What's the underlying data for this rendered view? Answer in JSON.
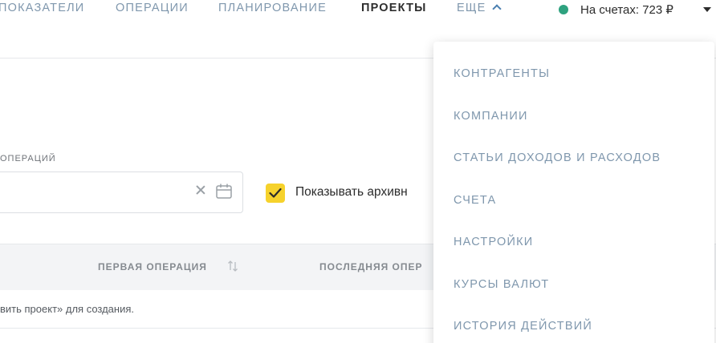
{
  "nav": {
    "items": [
      {
        "label": "ПОКАЗАТЕЛИ"
      },
      {
        "label": "ОПЕРАЦИИ"
      },
      {
        "label": "ПЛАНИРОВАНИЕ"
      },
      {
        "label": "ПРОЕКТЫ"
      },
      {
        "label": "ЕЩЕ"
      }
    ],
    "balance": "На счетах: 723 ₽"
  },
  "filters": {
    "date_label": "ОПЕРАЦИЙ",
    "show_archived_label": "Показывать архивн",
    "show_archived_checked": true
  },
  "table": {
    "columns": [
      "ПЕРВАЯ ОПЕРАЦИЯ",
      "ПОСЛЕДНЯЯ ОПЕР"
    ],
    "empty_text": "вить проект» для создания."
  },
  "dropdown": {
    "items": [
      "КОНТРАГЕНТЫ",
      "КОМПАНИИ",
      "СТАТЬИ ДОХОДОВ И РАСХОДОВ",
      "СЧЕТА",
      "НАСТРОЙКИ",
      "КУРСЫ ВАЛЮТ",
      "ИСТОРИЯ ДЕЙСТВИЙ"
    ]
  },
  "colors": {
    "accent": "#f6d22c",
    "status": "#2ea27f",
    "nav_link": "#7f97ad"
  },
  "icons": [
    "chevron-up-icon",
    "status-dot-icon",
    "caret-down-icon",
    "clear-icon",
    "calendar-icon",
    "checkmark-icon",
    "sort-icon"
  ]
}
